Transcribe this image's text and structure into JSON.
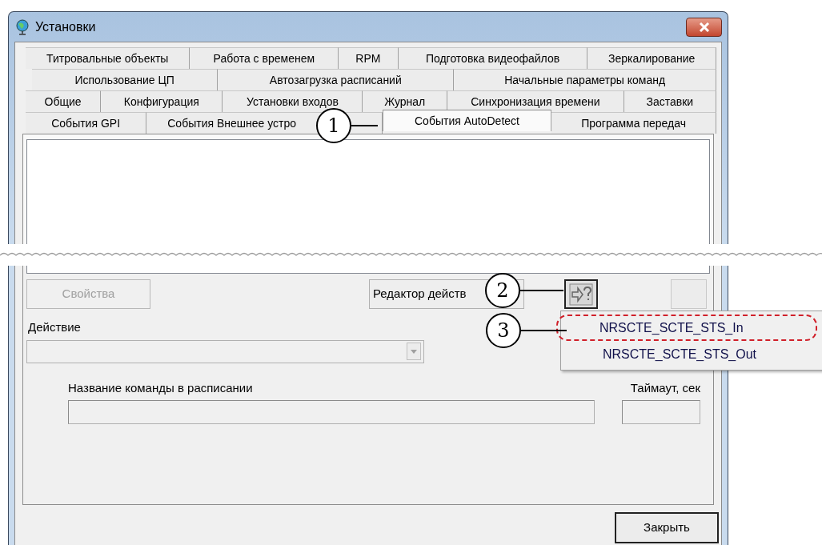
{
  "window": {
    "title": "Установки"
  },
  "tab_rows": [
    [
      {
        "label": "Титровальные объекты",
        "selected": false
      },
      {
        "label": "Работа с временем",
        "selected": false
      },
      {
        "label": "RPM",
        "selected": false
      },
      {
        "label": "Подготовка видеофайлов",
        "selected": false
      },
      {
        "label": "Зеркалирование",
        "selected": false
      }
    ],
    [
      {
        "label": "Использование ЦП",
        "selected": false
      },
      {
        "label": "Автозагрузка расписаний",
        "selected": false
      },
      {
        "label": "Начальные параметры команд",
        "selected": false
      }
    ],
    [
      {
        "label": "Общие",
        "selected": false
      },
      {
        "label": "Конфигурация",
        "selected": false
      },
      {
        "label": "Установки входов",
        "selected": false
      },
      {
        "label": "Журнал",
        "selected": false
      },
      {
        "label": "Синхронизация времени",
        "selected": false
      },
      {
        "label": "Заставки",
        "selected": false
      }
    ],
    [
      {
        "label": "События GPI",
        "selected": false
      },
      {
        "label": "События Внешнее устро",
        "selected": false
      },
      {
        "label": "События AutoDetect",
        "selected": true
      },
      {
        "label": "Программа передач",
        "selected": false
      }
    ]
  ],
  "properties_button": {
    "label": "Свойства",
    "disabled": true
  },
  "action_editor_button": {
    "label": "Редактор действ",
    "disabled": false
  },
  "action": {
    "label": "Действие",
    "disabled": true
  },
  "schedule_command": {
    "label": "Название команды в расписании"
  },
  "timeout": {
    "label": "Таймаут, сек"
  },
  "menu": {
    "items": [
      {
        "label": "NRSCTE_SCTE_STS_In",
        "marked": true
      },
      {
        "label": "NRSCTE_SCTE_STS_Out",
        "marked": false
      }
    ]
  },
  "callouts": [
    "1",
    "2",
    "3"
  ],
  "close_button": {
    "label": "Закрыть"
  }
}
